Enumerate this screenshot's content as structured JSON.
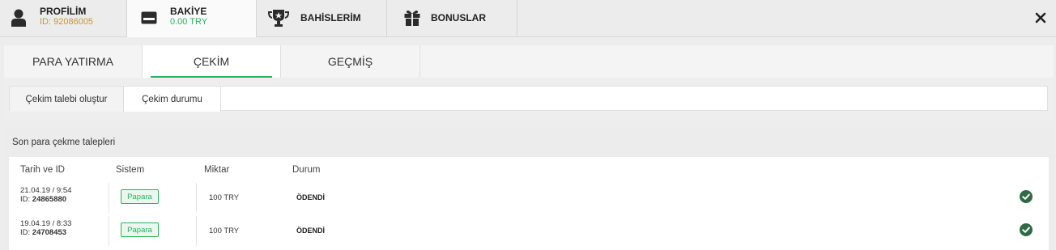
{
  "header": {
    "tabs": [
      {
        "name": "profile",
        "label": "PROFİLİM",
        "sub": "ID: 92086005",
        "sub_color": "#c8963c",
        "icon": "user-icon"
      },
      {
        "name": "balance",
        "label": "BAKİYE",
        "sub": "0.00 TRY",
        "sub_color": "#2fb25c",
        "icon": "wallet-icon"
      },
      {
        "name": "bets",
        "label": "BAHİSLERİM",
        "icon": "trophy-icon"
      },
      {
        "name": "bonuses",
        "label": "BONUSLAR",
        "icon": "gift-icon"
      }
    ],
    "close_icon": "close-icon"
  },
  "section_tabs": [
    "PARA YATIRMA",
    "ÇEKİM",
    "GEÇMİŞ"
  ],
  "withdraw_tabs": [
    "Çekim talebi oluştur",
    "Çekim durumu"
  ],
  "history": {
    "title": "Son para çekme talepleri",
    "columns": [
      "Tarih ve ID",
      "Sistem",
      "Miktar",
      "Durum"
    ],
    "rows": [
      {
        "date": "21.04.19 / 9:54",
        "id_label": "ID:",
        "id": "24865880",
        "system": "Papara",
        "amount": "100 TRY",
        "status": "ÖDENDİ"
      },
      {
        "date": "19.04.19 / 8:33",
        "id_label": "ID:",
        "id": "24708453",
        "system": "Papara",
        "amount": "100 TRY",
        "status": "ÖDENDİ"
      }
    ]
  },
  "colors": {
    "accent_green": "#2fb25c",
    "id_gold": "#c8963c",
    "icon_dark": "#2b2b2b"
  }
}
